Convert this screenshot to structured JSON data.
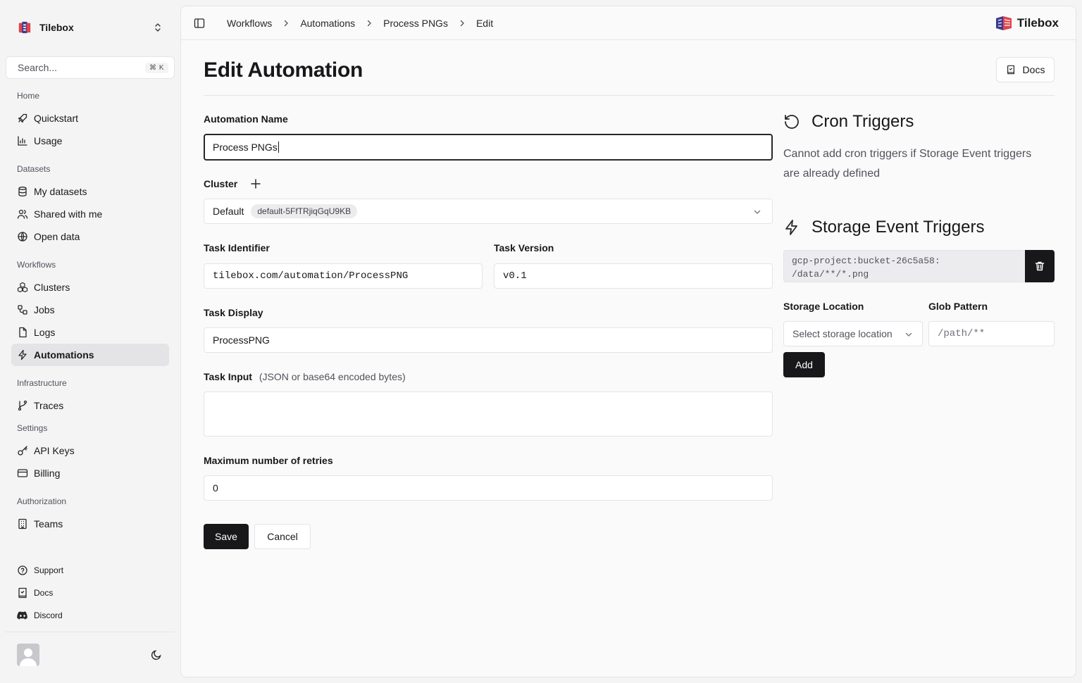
{
  "sidebar": {
    "team_name": "Tilebox",
    "search_placeholder": "Search...",
    "search_shortcut": "⌘ K",
    "sections": {
      "home": "Home",
      "datasets": "Datasets",
      "workflows": "Workflows",
      "infrastructure": "Infrastructure",
      "settings": "Settings",
      "authorization": "Authorization"
    },
    "items": {
      "quickstart": "Quickstart",
      "usage": "Usage",
      "my_datasets": "My datasets",
      "shared_with_me": "Shared with me",
      "open_data": "Open data",
      "clusters": "Clusters",
      "jobs": "Jobs",
      "logs": "Logs",
      "automations": "Automations",
      "traces": "Traces",
      "api_keys": "API Keys",
      "billing": "Billing",
      "teams": "Teams"
    },
    "footer": {
      "support": "Support",
      "docs": "Docs",
      "discord": "Discord"
    },
    "active_item": "Automations"
  },
  "header": {
    "breadcrumbs": [
      "Workflows",
      "Automations",
      "Process PNGs",
      "Edit"
    ],
    "brand": "Tilebox"
  },
  "page": {
    "title": "Edit Automation",
    "docs_label": "Docs"
  },
  "form": {
    "automation_name_label": "Automation Name",
    "automation_name_value": "Process PNGs",
    "cluster_label": "Cluster",
    "cluster_name": "Default",
    "cluster_id": "default-5FfTRjiqGqU9KB",
    "task_identifier_label": "Task Identifier",
    "task_identifier_value": "tilebox.com/automation/ProcessPNG",
    "task_version_label": "Task Version",
    "task_version_value": "v0.1",
    "task_display_label": "Task Display",
    "task_display_value": "ProcessPNG",
    "task_input_label": "Task Input",
    "task_input_hint": "(JSON or base64 encoded bytes)",
    "task_input_value": "",
    "max_retries_label": "Maximum number of retries",
    "max_retries_value": "0",
    "save_label": "Save",
    "cancel_label": "Cancel"
  },
  "cron": {
    "title": "Cron Triggers",
    "message_line1": "Cannot add cron triggers if Storage Event triggers",
    "message_line2": "are already defined"
  },
  "storage": {
    "title": "Storage Event Triggers",
    "existing_trigger_line1": "gcp-project:bucket-26c5a58:",
    "existing_trigger_line2": "/data/**/*.png",
    "storage_location_label": "Storage Location",
    "storage_location_placeholder": "Select storage location",
    "glob_pattern_label": "Glob Pattern",
    "glob_pattern_placeholder": "/path/**",
    "add_label": "Add"
  },
  "colors": {
    "accent_dark": "#18181b",
    "brand_red": "#e0434b",
    "active_nav_bg": "#e4e4e7"
  }
}
